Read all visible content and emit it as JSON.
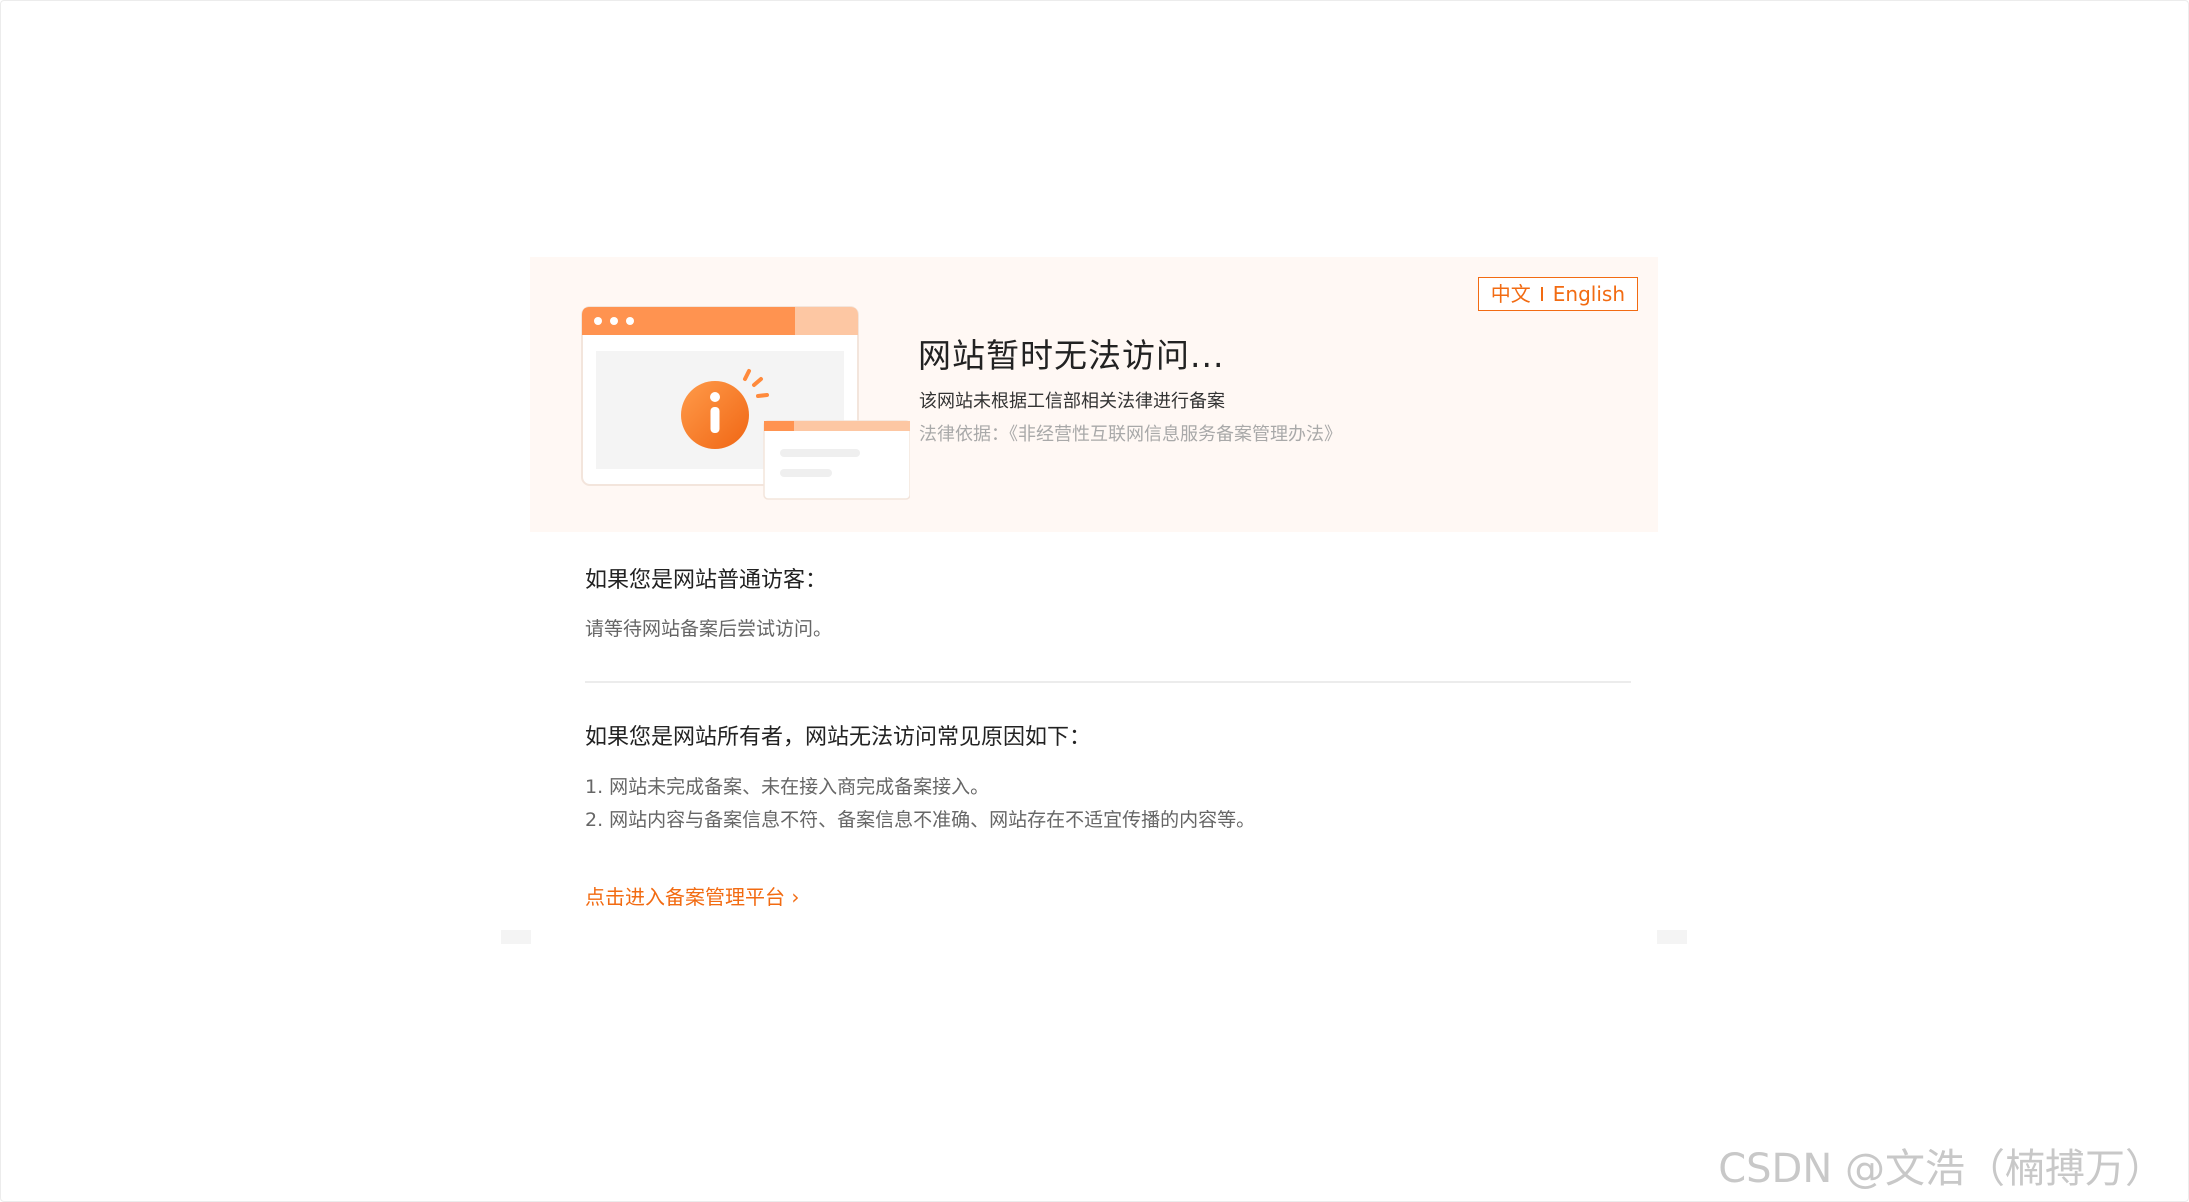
{
  "hero": {
    "title": "网站暂时无法访问...",
    "description": "该网站未根据工信部相关法律进行备案",
    "legal_basis": "法律依据：《非经营性互联网信息服务备案管理办法》"
  },
  "language_switch": {
    "chinese_label": "中文",
    "english_label": "English"
  },
  "visitor_section": {
    "title": "如果您是网站普通访客：",
    "text": "请等待网站备案后尝试访问。"
  },
  "owner_section": {
    "title": "如果您是网站所有者，网站无法访问常见原因如下：",
    "reasons": [
      "1. 网站未完成备案、未在接入商完成备案接入。",
      "2. 网站内容与备案信息不符、备案信息不准确、网站存在不适宜传播的内容等。"
    ]
  },
  "link": {
    "label": "点击进入备案管理平台",
    "arrow": "›"
  },
  "watermark": "CSDN @文浩（楠搏万）",
  "colors": {
    "accent": "#f26b12",
    "hero_background": "#fff8f4"
  },
  "icons": [
    "info-icon",
    "browser-window-illustration"
  ]
}
